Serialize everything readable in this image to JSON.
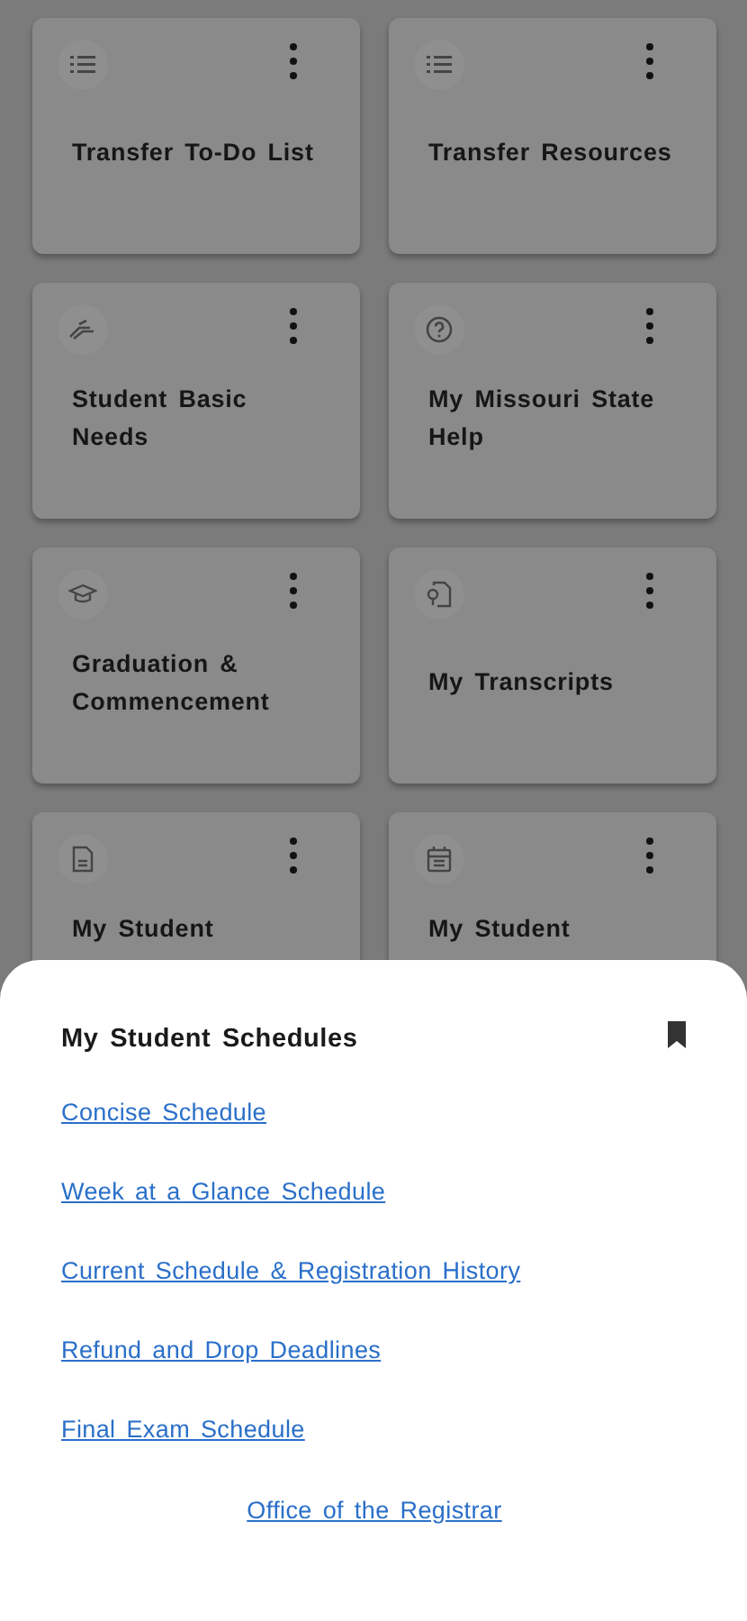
{
  "tiles": [
    {
      "title": "Transfer To-Do List"
    },
    {
      "title": "Transfer Resources"
    },
    {
      "title": "Student Basic Needs"
    },
    {
      "title": "My Missouri State Help"
    },
    {
      "title": "Graduation & Commencement"
    },
    {
      "title": "My Transcripts"
    },
    {
      "title": "My Student"
    },
    {
      "title": "My Student"
    }
  ],
  "sheet": {
    "title": "My Student Schedules",
    "bookmarked": true,
    "links": [
      "Concise Schedule",
      "Week at a Glance Schedule",
      "Current Schedule & Registration History",
      "Refund and Drop Deadlines",
      "Final Exam Schedule"
    ],
    "footer_link": "Office of the Registrar"
  }
}
